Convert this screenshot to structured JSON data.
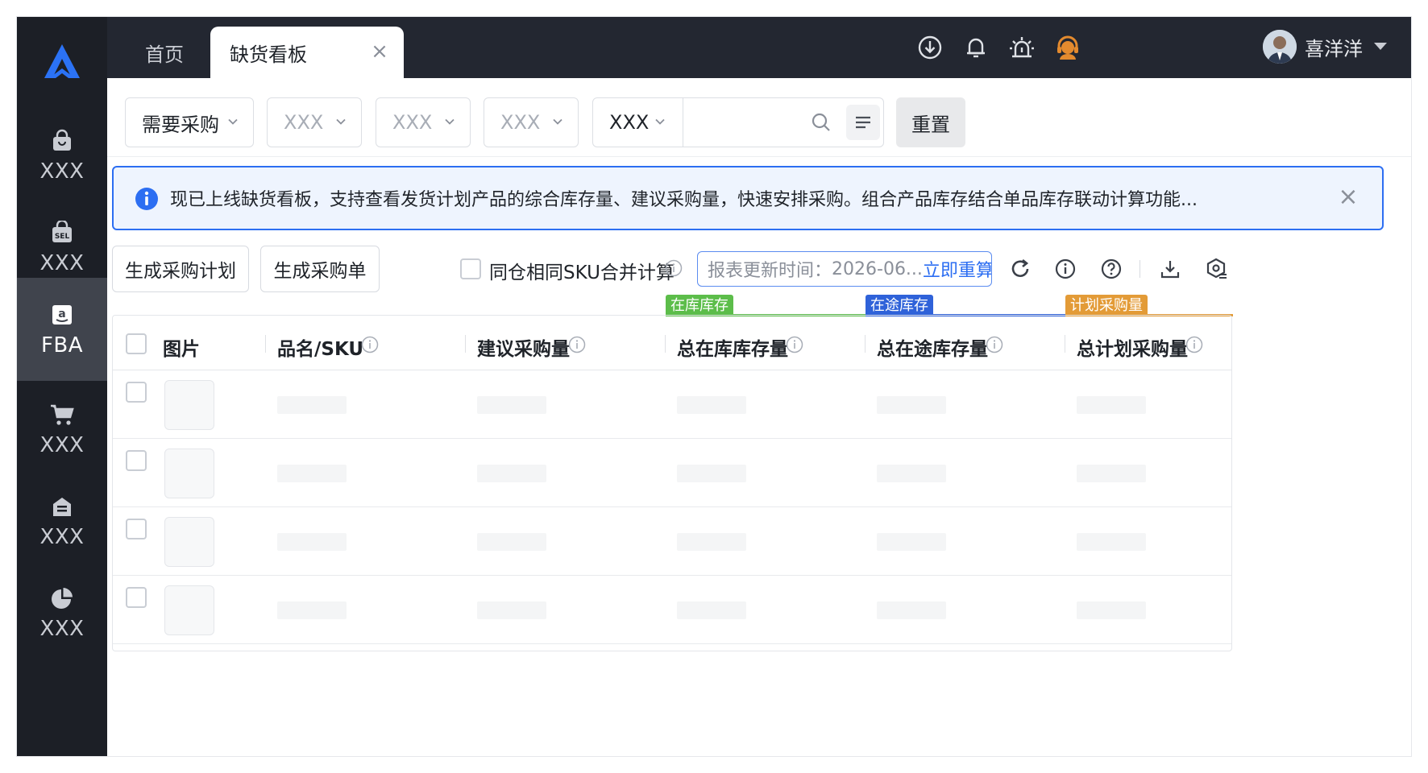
{
  "sidebar": {
    "items": [
      {
        "label": "XXX",
        "icon": "shopping-bag-icon",
        "active": false
      },
      {
        "label": "XXX",
        "icon": "sel-bag-icon",
        "active": false
      },
      {
        "label": "FBA",
        "icon": "amazon-icon",
        "active": true
      },
      {
        "label": "XXX",
        "icon": "cart-icon",
        "active": false
      },
      {
        "label": "XXX",
        "icon": "warehouse-bag-icon",
        "active": false
      },
      {
        "label": "XXX",
        "icon": "pie-chart-icon",
        "active": false
      }
    ]
  },
  "tabs": {
    "home": "首页",
    "active": "缺货看板",
    "close": "×"
  },
  "header": {
    "username": "喜洋洋",
    "icons": [
      "download-icon",
      "bell-icon",
      "alarm-icon",
      "customer-service-icon"
    ]
  },
  "filters": {
    "selects": [
      "需要采购",
      "XXX",
      "XXX",
      "XXX"
    ],
    "search_prefix": "XXX",
    "search_value": "",
    "reset_label": "重置"
  },
  "notice": {
    "text": "现已上线缺货看板，支持查看发货计划产品的综合库存量、建议采购量，快速安排采购。组合产品库存结合单品库存联动计算功能...",
    "close": "×"
  },
  "actions": {
    "gen_plan": "生成采购计划",
    "gen_order": "生成采购单",
    "merge_label": "同仓相同SKU合并计算",
    "report_label": "报表更新时间：",
    "report_value": "2026-06...",
    "recalc_link": "立即重算"
  },
  "groups": {
    "in_stock": "在库库存",
    "in_transit": "在途库存",
    "planned": "计划采购量"
  },
  "colors": {
    "in_stock": "#5cbd4a",
    "in_transit": "#2f62d9",
    "planned": "#e39b37",
    "accent": "#2c6ef2"
  },
  "table": {
    "columns": [
      "图片",
      "品名/SKU",
      "建议采购量",
      "总在库库存量",
      "总在途库存量",
      "总计划采购量"
    ],
    "row_count": 4
  }
}
